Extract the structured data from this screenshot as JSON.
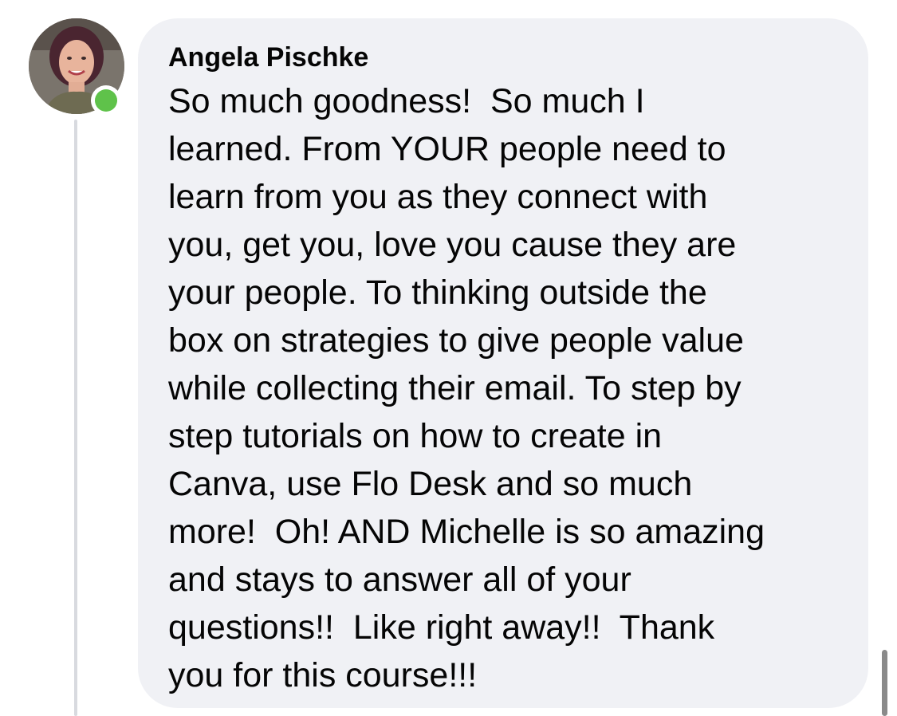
{
  "comment": {
    "author": "Angela Pischke",
    "text_lines": [
      "So much goodness!  So much I",
      "learned. From YOUR people need to",
      "learn from you as they connect with",
      "you, get you, love you cause they are",
      "your people. To thinking outside the",
      "box on strategies to give people value",
      "while collecting their email. To step by",
      "step tutorials on how to create in",
      "Canva, use Flo Desk and so much",
      "more!  Oh! AND Michelle is so amazing",
      "and stays to answer all of your",
      "questions!!  Like right away!!  Thank",
      "you for this course!!!"
    ],
    "online": true
  },
  "colors": {
    "bubble_background": "#f0f1f5",
    "online_status": "#5fc24a",
    "thread_line": "#d8dadf",
    "text": "#050505"
  },
  "icons": {
    "avatar": "profile-photo",
    "status": "online-status-dot"
  }
}
